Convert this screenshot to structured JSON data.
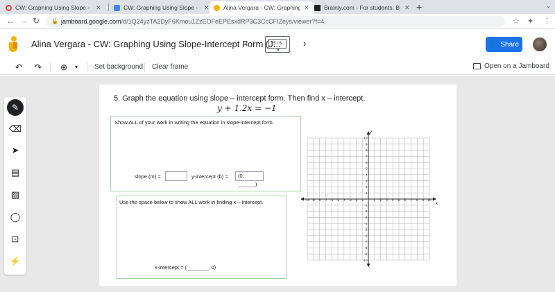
{
  "tabs": [
    {
      "title": "CW: Graphing Using Slope - Inter",
      "favicon_color": "#e94235",
      "active": false
    },
    {
      "title": "CW: Graphing Using Slope - Inter",
      "favicon_color": "#4285f4",
      "active": false
    },
    {
      "title": "Alina Vergara - CW: Graphing Us",
      "favicon_color": "#f4b400",
      "active": true
    },
    {
      "title": "Brainly.com - For students. By st",
      "favicon_color": "#202124",
      "active": false
    }
  ],
  "address": {
    "host": "jamboard.google.com",
    "path": "/d/1Q24yzTA2DyF6Kmou1ZzEOFeEPEsxdRP3C3CcCFIZeys/viewer?f=4"
  },
  "header": {
    "title": "Alina Vergara - CW: Graphing Using Slope-Intercept Form (J...",
    "frame_indicator": "5 / 6",
    "share_label": "Share"
  },
  "toolbar": {
    "set_background": "Set background",
    "clear_frame": "Clear frame",
    "open_jamboard": "Open on a Jamboard"
  },
  "page": {
    "question": "5.  Graph the equation using slope – intercept form.  Then find x – intercept.",
    "equation": "y + 1.2x = −1",
    "box1_header": "Show ALL of your work in writing the equation in slope-intercept form.",
    "slope_label": "slope (m) =",
    "yint_label": "y-intercept (b) =",
    "yint_value": "(0, ______)",
    "box2_header": "Use the space below to show ALL work in finding x – intercept.",
    "xint_label": "x-intercept = ( _______, 0)"
  },
  "graph": {
    "x_axis_label": "x",
    "y_axis_label": "y",
    "x_ticks": [
      "-10",
      "-9",
      "-8",
      "-7",
      "-6",
      "-5",
      "-4",
      "-3",
      "-2",
      "-1",
      "1",
      "2",
      "3",
      "4",
      "5",
      "6",
      "7",
      "8",
      "9",
      "10"
    ],
    "y_ticks": [
      "10",
      "9",
      "8",
      "7",
      "6",
      "5",
      "4",
      "3",
      "2",
      "1",
      "-1",
      "-2",
      "-3",
      "-4",
      "-5",
      "-6",
      "-7",
      "-8",
      "-9",
      "-10"
    ]
  }
}
